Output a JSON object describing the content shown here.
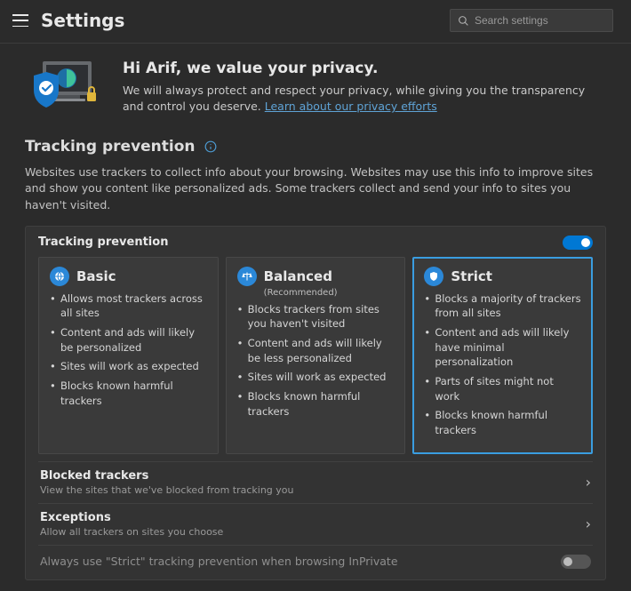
{
  "header": {
    "title": "Settings",
    "search_placeholder": "Search settings"
  },
  "banner": {
    "heading": "Hi Arif, we value your privacy.",
    "body": "We will always protect and respect your privacy, while giving you the transparency and control you deserve. ",
    "link_text": "Learn about our privacy efforts"
  },
  "tracking": {
    "title": "Tracking prevention",
    "desc": "Websites use trackers to collect info about your browsing. Websites may use this info to improve sites and show you content like personalized ads. Some trackers collect and send your info to sites you haven't visited.",
    "panel_label": "Tracking prevention",
    "toggle_on": true,
    "cards": {
      "basic": {
        "title": "Basic",
        "b1": "Allows most trackers across all sites",
        "b2": "Content and ads will likely be personalized",
        "b3": "Sites will work as expected",
        "b4": "Blocks known harmful trackers"
      },
      "balanced": {
        "title": "Balanced",
        "sub": "(Recommended)",
        "b1": "Blocks trackers from sites you haven't visited",
        "b2": "Content and ads will likely be less personalized",
        "b3": "Sites will work as expected",
        "b4": "Blocks known harmful trackers"
      },
      "strict": {
        "title": "Strict",
        "b1": "Blocks a majority of trackers from all sites",
        "b2": "Content and ads will likely have minimal personalization",
        "b3": "Parts of sites might not work",
        "b4": "Blocks known harmful trackers"
      }
    },
    "blocked": {
      "title": "Blocked trackers",
      "desc": "View the sites that we've blocked from tracking you"
    },
    "exceptions": {
      "title": "Exceptions",
      "desc": "Allow all trackers on sites you choose"
    },
    "inprivate_label": "Always use \"Strict\" tracking prevention when browsing InPrivate"
  }
}
